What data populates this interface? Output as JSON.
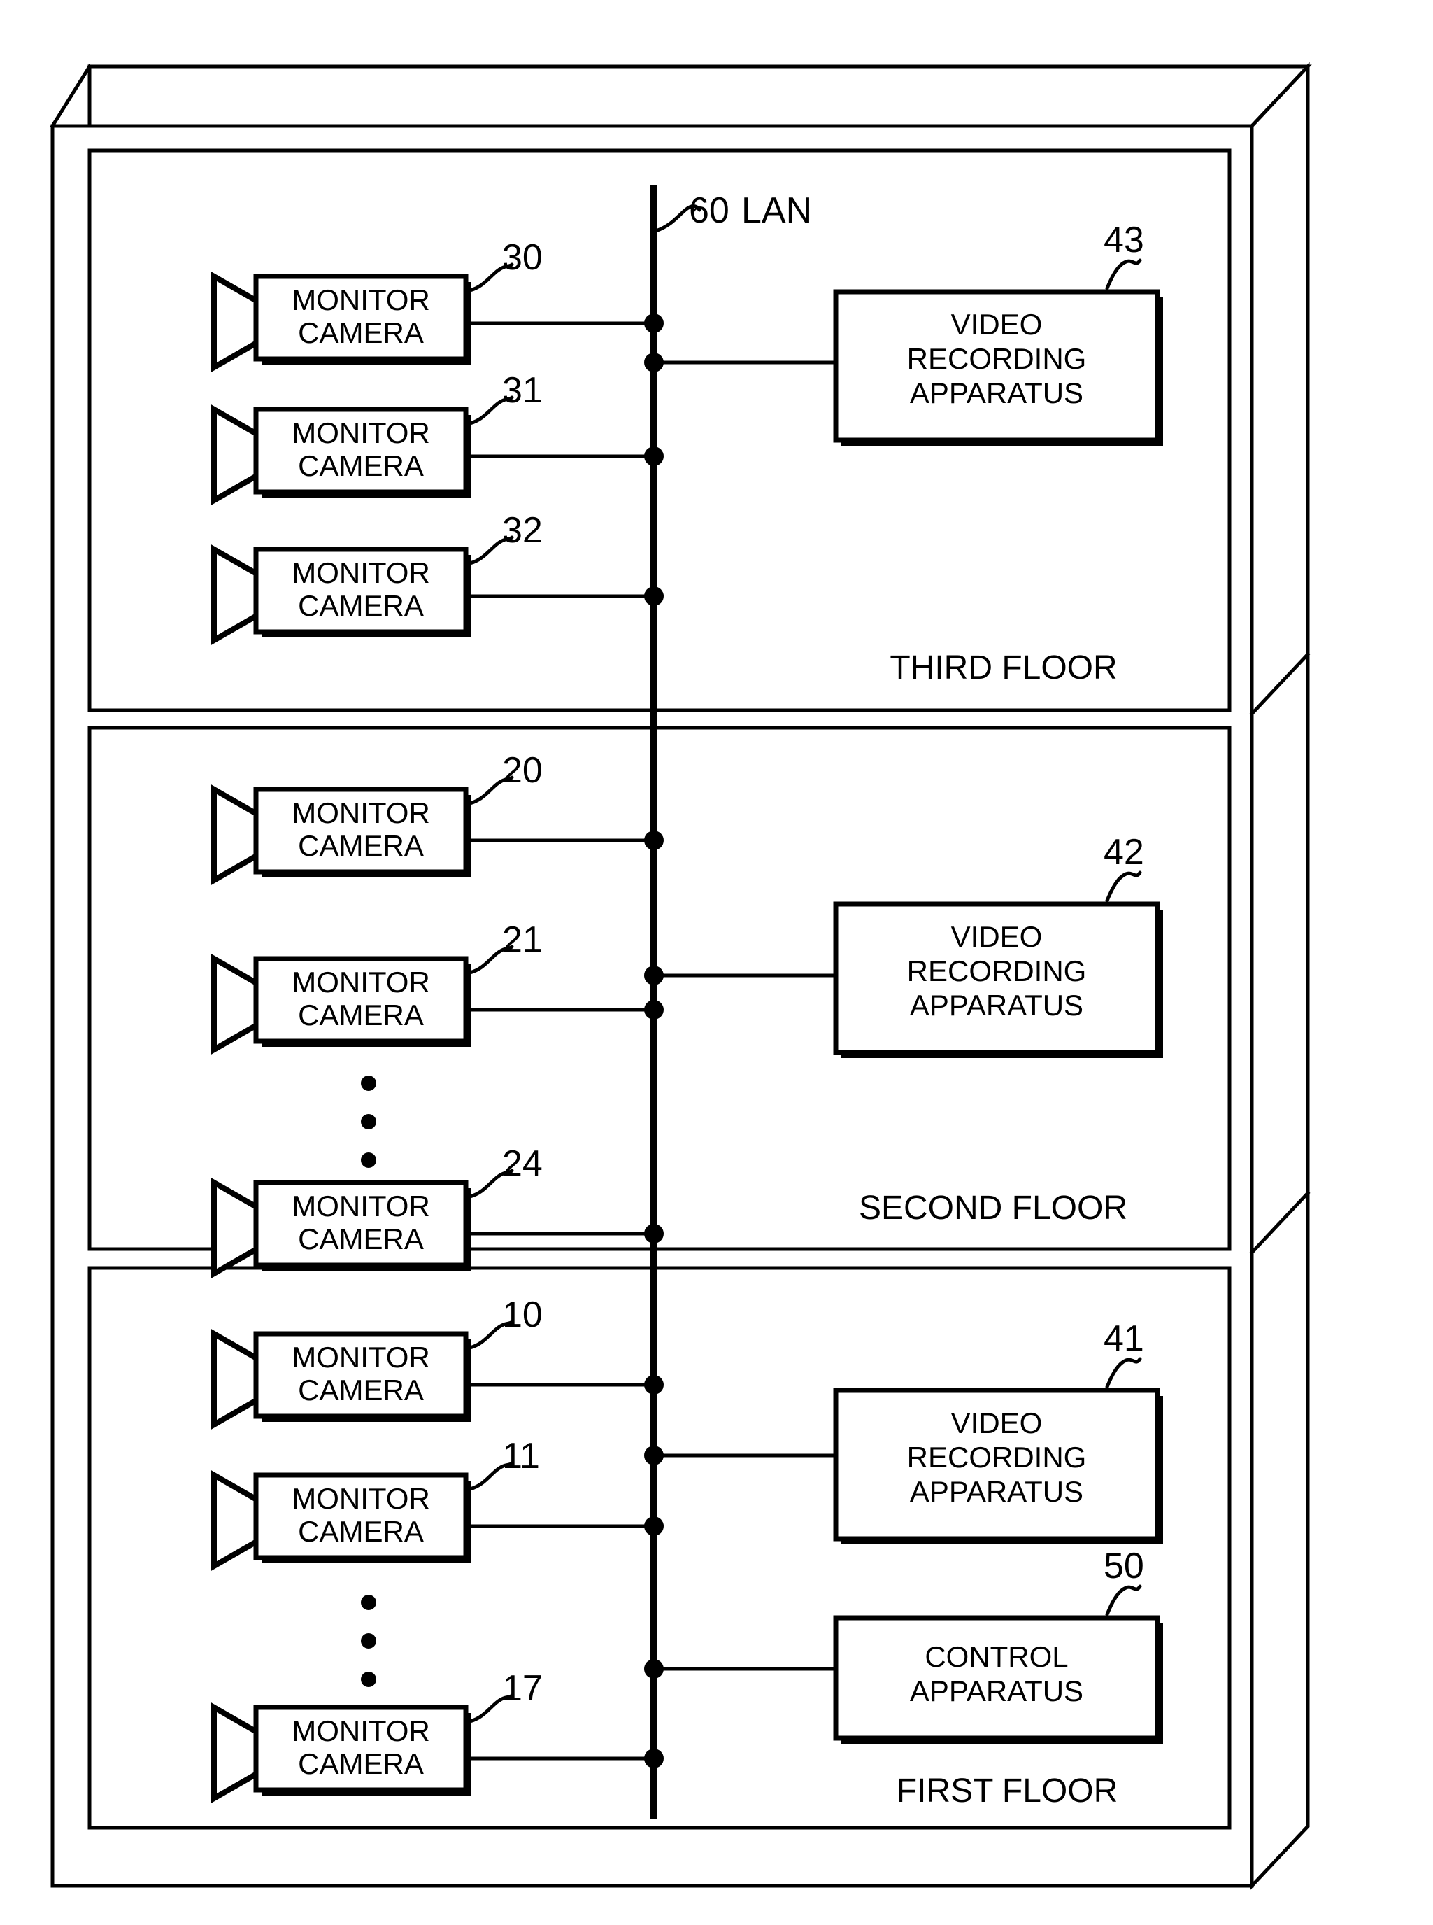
{
  "figure": {
    "type": "patent-diagram",
    "title": "Building monitor camera network diagram",
    "network": {
      "bus_label": "LAN",
      "bus_ref": "60"
    },
    "floors": [
      {
        "id": "third",
        "label": "THIRD FLOOR",
        "cameras": [
          {
            "ref": "30",
            "label_line1": "MONITOR",
            "label_line2": "CAMERA"
          },
          {
            "ref": "31",
            "label_line1": "MONITOR",
            "label_line2": "CAMERA"
          },
          {
            "ref": "32",
            "label_line1": "MONITOR",
            "label_line2": "CAMERA"
          }
        ],
        "has_ellipsis": false,
        "devices": [
          {
            "ref": "43",
            "kind": "video-recording-apparatus",
            "label_line1": "VIDEO",
            "label_line2": "RECORDING",
            "label_line3": "APPARATUS"
          }
        ]
      },
      {
        "id": "second",
        "label": "SECOND FLOOR",
        "cameras": [
          {
            "ref": "20",
            "label_line1": "MONITOR",
            "label_line2": "CAMERA"
          },
          {
            "ref": "21",
            "label_line1": "MONITOR",
            "label_line2": "CAMERA"
          },
          {
            "ref": "24",
            "label_line1": "MONITOR",
            "label_line2": "CAMERA"
          }
        ],
        "has_ellipsis": true,
        "devices": [
          {
            "ref": "42",
            "kind": "video-recording-apparatus",
            "label_line1": "VIDEO",
            "label_line2": "RECORDING",
            "label_line3": "APPARATUS"
          }
        ]
      },
      {
        "id": "first",
        "label": "FIRST FLOOR",
        "cameras": [
          {
            "ref": "10",
            "label_line1": "MONITOR",
            "label_line2": "CAMERA"
          },
          {
            "ref": "11",
            "label_line1": "MONITOR",
            "label_line2": "CAMERA"
          },
          {
            "ref": "17",
            "label_line1": "MONITOR",
            "label_line2": "CAMERA"
          }
        ],
        "has_ellipsis": true,
        "devices": [
          {
            "ref": "41",
            "kind": "video-recording-apparatus",
            "label_line1": "VIDEO",
            "label_line2": "RECORDING",
            "label_line3": "APPARATUS"
          },
          {
            "ref": "50",
            "kind": "control-apparatus",
            "label_line1": "CONTROL",
            "label_line2": "APPARATUS",
            "label_line3": ""
          }
        ]
      }
    ],
    "colors": {
      "ink": "#000000",
      "paper": "#ffffff"
    }
  }
}
